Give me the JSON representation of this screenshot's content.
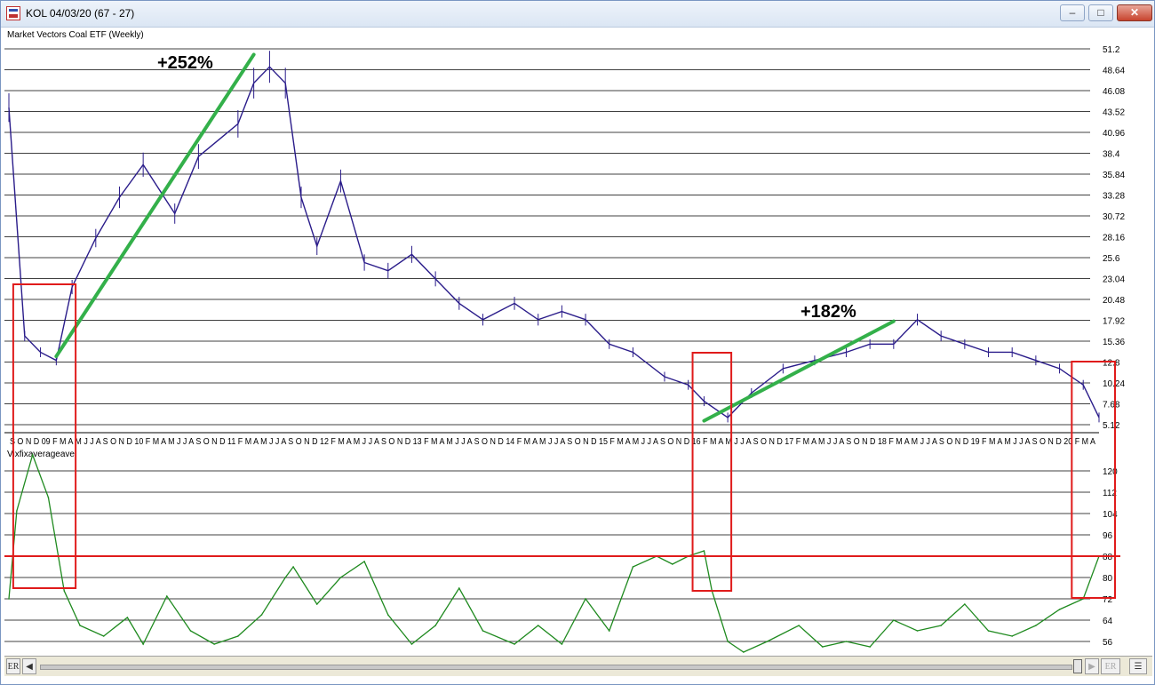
{
  "window": {
    "title": "KOL 04/03/20 (67 - 27)",
    "buttons": {
      "minimize": "–",
      "maximize": "□",
      "close": "✕"
    }
  },
  "colors": {
    "price_line": "#2a1c8a",
    "indicator_line": "#1f8a1f",
    "trend_line": "#33b04a",
    "highlight_box": "#e01b1b",
    "grid": "#000000"
  },
  "price_panel": {
    "title": "Market Vectors Coal ETF (Weekly)",
    "y_labels": [
      "51.2",
      "48.64",
      "46.08",
      "43.52",
      "40.96",
      "38.4",
      "35.84",
      "33.28",
      "30.72",
      "28.16",
      "25.6",
      "23.04",
      "20.48",
      "17.92",
      "15.36",
      "12.8",
      "10.24",
      "7.68",
      "5.12"
    ],
    "annotations": [
      "+252%",
      "+182%"
    ]
  },
  "indicator_panel": {
    "title": "Vixfixaverageave",
    "y_labels": [
      "120",
      "112",
      "104",
      "96",
      "88",
      "80",
      "72",
      "64",
      "56"
    ]
  },
  "x_axis_labels": "S O N D 09 F M A M J J A S O N D 10 F M A M J J A S O N D 11 F M A M J J A S O N D 12 F M A M J J A S O N D 13 F M A M J J A S O N D 14 F M A M J J A S O N D 15 F M A M J J A S O N D 16 F M A M J J A S O N D 17 F M A M J J A S O N D 18 F M A M J J A S O N D 19 F M A M J J A S O N D 20 F M A",
  "scrollbar": {
    "left_label": "ER",
    "left_arrow": "◀",
    "right_arrow": "▶",
    "right_label": "ER",
    "menu": "☰"
  },
  "chart_data": [
    {
      "type": "line",
      "title": "Market Vectors Coal ETF (Weekly)",
      "ylim": [
        5.12,
        51.2
      ],
      "x": [
        "2008-09",
        "2008-11",
        "2009-01",
        "2009-03",
        "2009-05",
        "2009-08",
        "2009-11",
        "2010-02",
        "2010-06",
        "2010-09",
        "2011-02",
        "2011-04",
        "2011-06",
        "2011-08",
        "2011-10",
        "2011-12",
        "2012-03",
        "2012-06",
        "2012-09",
        "2012-12",
        "2013-03",
        "2013-06",
        "2013-09",
        "2014-01",
        "2014-04",
        "2014-07",
        "2014-10",
        "2015-01",
        "2015-04",
        "2015-08",
        "2015-11",
        "2016-01",
        "2016-04",
        "2016-07",
        "2016-11",
        "2017-03",
        "2017-07",
        "2017-10",
        "2018-01",
        "2018-04",
        "2018-07",
        "2018-10",
        "2019-01",
        "2019-04",
        "2019-07",
        "2019-10",
        "2020-01",
        "2020-03"
      ],
      "series": [
        {
          "values": [
            44,
            16,
            14,
            13,
            22,
            28,
            33,
            37,
            31,
            38,
            42,
            47,
            49,
            47,
            33,
            27,
            35,
            25,
            24,
            26,
            23,
            20,
            18,
            20,
            18,
            19,
            18,
            15,
            14,
            11,
            10,
            8,
            6,
            9,
            12,
            13,
            14,
            15,
            15,
            18,
            16,
            15,
            14,
            14,
            13,
            12,
            10,
            6
          ]
        }
      ],
      "annotations": [
        {
          "text": "+252%",
          "from": {
            "x": "2009-03",
            "y": 13.5
          },
          "to": {
            "x": "2011-04",
            "y": 50.5
          }
        },
        {
          "text": "+182%",
          "from": {
            "x": "2016-01",
            "y": 5.6
          },
          "to": {
            "x": "2018-01",
            "y": 17.8
          }
        }
      ],
      "highlight_periods": [
        [
          "2008-10",
          "2009-05"
        ],
        [
          "2015-12",
          "2016-04"
        ],
        [
          "2019-12",
          "2020-03"
        ]
      ]
    },
    {
      "type": "line",
      "title": "Vixfixaverageave",
      "ylim": [
        52,
        132
      ],
      "x": [
        "2008-09",
        "2008-10",
        "2008-12",
        "2009-02",
        "2009-04",
        "2009-06",
        "2009-09",
        "2009-12",
        "2010-02",
        "2010-05",
        "2010-08",
        "2010-11",
        "2011-02",
        "2011-05",
        "2011-08",
        "2011-09",
        "2011-12",
        "2012-03",
        "2012-06",
        "2012-09",
        "2012-12",
        "2013-03",
        "2013-06",
        "2013-09",
        "2014-01",
        "2014-04",
        "2014-07",
        "2014-10",
        "2015-01",
        "2015-04",
        "2015-07",
        "2015-09",
        "2015-11",
        "2016-01",
        "2016-02",
        "2016-04",
        "2016-06",
        "2016-09",
        "2017-01",
        "2017-04",
        "2017-07",
        "2017-10",
        "2018-01",
        "2018-04",
        "2018-07",
        "2018-10",
        "2019-01",
        "2019-04",
        "2019-07",
        "2019-10",
        "2020-01",
        "2020-03"
      ],
      "series": [
        {
          "values": [
            72,
            105,
            126,
            110,
            75,
            62,
            58,
            65,
            55,
            73,
            60,
            55,
            58,
            66,
            80,
            84,
            70,
            80,
            86,
            66,
            55,
            62,
            76,
            60,
            55,
            62,
            55,
            72,
            60,
            84,
            88,
            85,
            88,
            90,
            75,
            56,
            52,
            56,
            62,
            54,
            56,
            54,
            64,
            60,
            62,
            70,
            60,
            58,
            62,
            68,
            72,
            88
          ]
        }
      ],
      "reference_line": 88,
      "highlight_periods": [
        [
          "2008-10",
          "2009-05"
        ],
        [
          "2015-12",
          "2016-04"
        ],
        [
          "2019-12",
          "2020-03"
        ]
      ]
    }
  ]
}
